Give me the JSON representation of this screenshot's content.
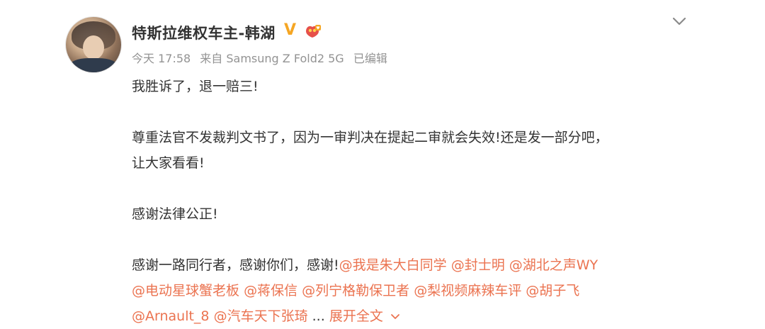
{
  "user": {
    "name": "特斯拉维权车主-韩湖",
    "verified_mark": "V"
  },
  "meta": {
    "time": "今天 17:58",
    "source": "来自 Samsung Z Fold2 5G",
    "edited": "已编辑"
  },
  "post": {
    "line1": "我胜诉了，退一赔三!",
    "line2": "尊重法官不发裁判文书了，因为一审判决在提起二审就会失效!还是发一部分吧，",
    "line3": "让大家看看!",
    "line4": "感谢法律公正!",
    "line5_text": "感谢一路同行者，感谢你们，感谢!",
    "mentions_line5": [
      "@我是朱大白同学",
      "@封士明",
      "@湖北之声WY"
    ],
    "mentions_line6": [
      "@电动星球蟹老板",
      "@蒋保信",
      "@列宁格勒保卫者",
      "@梨视频麻辣车评",
      "@胡子飞"
    ],
    "mentions_line7": [
      "@Arnault_8",
      "@汽车天下张琦"
    ],
    "ellipsis": "...",
    "expand_label": "展开全文"
  },
  "colors": {
    "mention": "#eb7350",
    "meta": "#939393",
    "text": "#333333",
    "verified": "#f5a623"
  }
}
